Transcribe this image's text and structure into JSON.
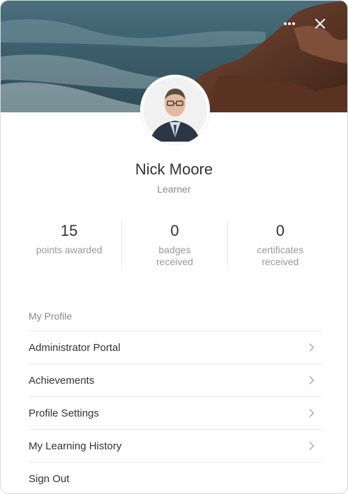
{
  "header": {
    "more_icon": "more-horizontal-icon",
    "close_icon": "close-icon"
  },
  "profile": {
    "name": "Nick Moore",
    "role": "Learner",
    "avatar_icon": "user-avatar"
  },
  "stats": [
    {
      "value": "15",
      "label": "points awarded"
    },
    {
      "value": "0",
      "label": "badges received"
    },
    {
      "value": "0",
      "label": "certificates received"
    }
  ],
  "section_title": "My Profile",
  "menu": [
    {
      "label": "Administrator Portal",
      "icon": "chevron-right-icon"
    },
    {
      "label": "Achievements",
      "icon": "chevron-right-icon"
    },
    {
      "label": "Profile Settings",
      "icon": "chevron-right-icon"
    },
    {
      "label": "My Learning History",
      "icon": "chevron-right-icon"
    },
    {
      "label": "Sign Out"
    }
  ],
  "colors": {
    "text": "#333333",
    "muted": "#888888",
    "divider": "#e8e8e8"
  }
}
